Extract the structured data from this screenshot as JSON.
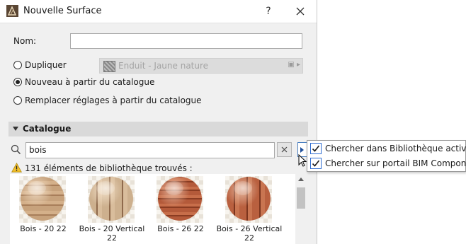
{
  "window": {
    "title": "Nouvelle Surface",
    "help_label": "?"
  },
  "form": {
    "name_label": "Nom:",
    "name_value": "",
    "option_duplicate": "Dupliquer",
    "duplicate_surface": "Enduit - Jaune nature",
    "option_new_catalog": "Nouveau à partir du catalogue",
    "option_replace_catalog": "Remplacer réglages à partir du catalogue",
    "selected_option": "option_new_catalog"
  },
  "catalog": {
    "section_title": "Catalogue",
    "search_value": "bois",
    "found_text": "131 éléments de bibliothèque trouvés :",
    "items": [
      {
        "caption": "Bois - 20 22",
        "icon": "wood-sphere-light-horizontal-icon"
      },
      {
        "caption": "Bois - 20 Vertical 22",
        "icon": "wood-sphere-light-vertical-icon"
      },
      {
        "caption": "Bois - 26 22",
        "icon": "wood-sphere-red-horizontal-icon"
      },
      {
        "caption": "Bois - 26 Vertical 22",
        "icon": "wood-sphere-red-vertical-icon"
      }
    ]
  },
  "search_options_menu": {
    "items": [
      {
        "label": "Chercher dans Bibliothèque active",
        "checked": true
      },
      {
        "label": "Chercher sur portail BIM Components",
        "checked": true
      }
    ]
  },
  "colors": {
    "accent": "#2d6bd0",
    "dialog_bg": "#f0f0f0",
    "section_bg": "#d9d9d9"
  }
}
